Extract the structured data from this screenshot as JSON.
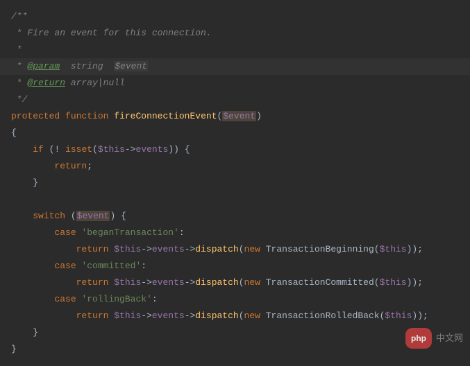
{
  "doc": {
    "open": "/**",
    "desc": " * Fire an event for this connection.",
    "blank": " *",
    "paramPrefix": " * ",
    "paramTag": "@param",
    "paramType": "string",
    "paramName": "$event",
    "returnTag": "@return",
    "returnType1": "array",
    "returnSep": "|",
    "returnType2": "null",
    "close": " */"
  },
  "sig": {
    "visibility": "protected",
    "fnKeyword": "function",
    "fnName": "fireConnectionEvent",
    "paren1": "(",
    "arg": "$event",
    "paren2": ")"
  },
  "body": {
    "braceOpen": "{",
    "braceClose": "}",
    "ifKeyword": "if",
    "notOp": "!",
    "isset": "isset",
    "thisVar": "$this",
    "arrow": "->",
    "eventsProp": "events",
    "returnKw": "return",
    "semi": ";",
    "switchKw": "switch",
    "eventVar": "$event",
    "caseKw": "case",
    "case1": "'beganTransaction'",
    "case2": "'committed'",
    "case3": "'rollingBack'",
    "colon": ":",
    "dispatch": "dispatch",
    "newKw": "new",
    "class1": "TransactionBeginning",
    "class2": "TransactionCommitted",
    "class3": "TransactionRolledBack"
  },
  "watermark": {
    "badge": "php",
    "text": "中文网"
  }
}
